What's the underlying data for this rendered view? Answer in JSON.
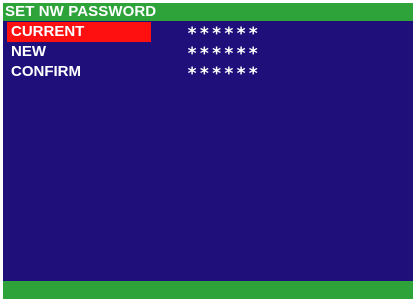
{
  "title": "SET NW PASSWORD",
  "menu": {
    "items": [
      {
        "label": "CURRENT",
        "value": "******",
        "selected": true
      },
      {
        "label": "NEW",
        "value": "******",
        "selected": false
      },
      {
        "label": "CONFIRM",
        "value": "******",
        "selected": false
      }
    ]
  },
  "colors": {
    "background": "#1f0f7a",
    "title_bar": "#2da33a",
    "footer_bar": "#2da33a",
    "selection": "#ff1010",
    "text": "#ffffff"
  }
}
